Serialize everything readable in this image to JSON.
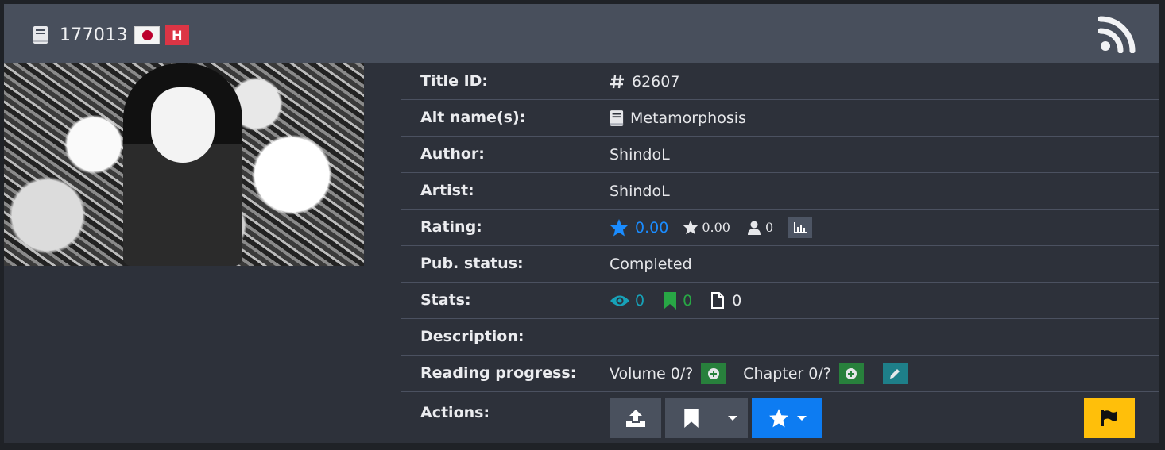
{
  "header": {
    "id_text": "177013",
    "badge": "H",
    "flag_icon": "japan-flag-icon",
    "rss_icon": "rss-icon"
  },
  "details": {
    "title_id_label": "Title ID:",
    "title_id_value": "62607",
    "alt_names_label": "Alt name(s):",
    "alt_name": "Metamorphosis",
    "author_label": "Author:",
    "author_value": "ShindoL",
    "artist_label": "Artist:",
    "artist_value": "ShindoL",
    "rating_label": "Rating:",
    "rating_bayesian": "0.00",
    "rating_mean": "0.00",
    "rating_users": "0",
    "pub_status_label": "Pub. status:",
    "pub_status_value": "Completed",
    "stats_label": "Stats:",
    "stats_views": "0",
    "stats_follows": "0",
    "stats_pages": "0",
    "description_label": "Description:",
    "reading_progress_label": "Reading progress:",
    "volume_progress": "Volume 0/?",
    "chapter_progress": "Chapter 0/?",
    "actions_label": "Actions:"
  },
  "colors": {
    "header_bg": "#484f5c",
    "card_bg": "#2d313a",
    "accent_blue": "#0d7cf2",
    "warning_yellow": "#ffbf0a",
    "danger_red": "#dc3545",
    "success_green": "#28a745",
    "info_teal": "#17a2b8"
  }
}
